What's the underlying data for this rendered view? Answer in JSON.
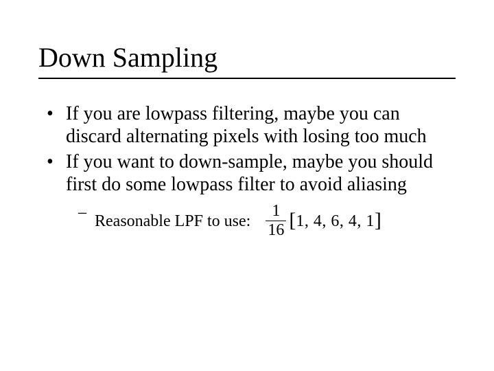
{
  "title": "Down Sampling",
  "bullets": [
    "If you are lowpass filtering, maybe you can discard alternating pixels with losing too much",
    "If you want to down-sample, maybe you should first do some lowpass filter to avoid aliasing"
  ],
  "subbullet_label": "Reasonable LPF to use:",
  "formula": {
    "numerator": "1",
    "denominator": "16",
    "left_bracket": "[",
    "vector": "1, 4, 6, 4, 1",
    "right_bracket": "]"
  }
}
